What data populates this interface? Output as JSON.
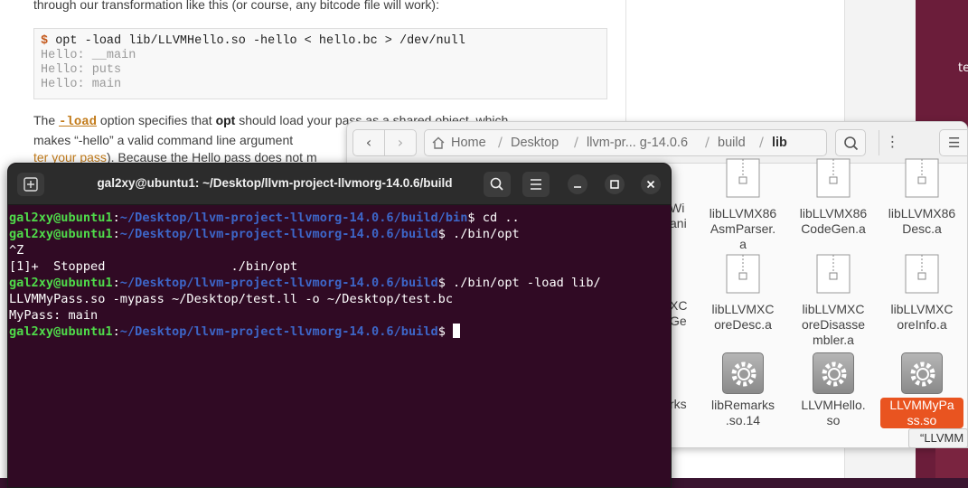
{
  "web": {
    "line1": "through our transformation like this (or course, any bitcode file will work):",
    "code": {
      "prompt": "$",
      "command": " opt -load lib/LLVMHello.so -hello < hello.bc > /dev/null",
      "out1": "Hello: __main",
      "out2": "Hello: puts",
      "out3": "Hello: main"
    },
    "para1_pre": "The ",
    "para1_opt": "-load",
    "para1_mid": " option specifies that ",
    "para1_bold": "opt",
    "para1_post": " should load your pass as a shared object, which",
    "para2": "makes “-hello” a valid command line argument",
    "para3_link": "ter your pass",
    "para3_post": "). Because the Hello pass does not m"
  },
  "desktop": {
    "strip_text": "te"
  },
  "file_manager": {
    "breadcrumbs": [
      "Home",
      "Desktop",
      "llvm-pr... g-14.0.6",
      "build",
      "lib"
    ],
    "path_menu": "⋮",
    "view_icon": "list-view-icon",
    "partial_labels": {
      "a1": "Wi",
      "a2": "ani",
      "b1": "XC",
      "b2": "Ge",
      "c1": "rks"
    },
    "items": [
      {
        "label": "libLLVMX86\nAsmParser.\na",
        "icon": "archive-icon"
      },
      {
        "label": "libLLVMX86\nCodeGen.a",
        "icon": "archive-icon"
      },
      {
        "label": "libLLVMX86\nDesc.a",
        "icon": "archive-icon"
      },
      {
        "label": "libLLVMXC\noreDesc.a",
        "icon": "archive-icon"
      },
      {
        "label": "libLLVMXC\noreDisasse\nmbler.a",
        "icon": "archive-icon"
      },
      {
        "label": "libLLVMXC\noreInfo.a",
        "icon": "archive-icon"
      },
      {
        "label": "libRemarks\n.so.14",
        "icon": "gear-icon"
      },
      {
        "label": "LLVMHello.\nso",
        "icon": "gear-icon"
      },
      {
        "label": "LLVMMyPa\nss.so",
        "icon": "gear-icon",
        "selected": true
      }
    ],
    "tooltip": "“LLVMM"
  },
  "terminal": {
    "title": "gal2xy@ubuntu1: ~/Desktop/llvm-project-llvmorg-14.0.6/build",
    "user": "gal2xy@ubuntu1",
    "lines": [
      {
        "path": "~/Desktop/llvm-project-llvmorg-14.0.6/build/bin",
        "cmd": "$ cd .."
      },
      {
        "path": "~/Desktop/llvm-project-llvmorg-14.0.6/build",
        "cmd": "$ ./bin/opt"
      },
      {
        "text": "^Z"
      },
      {
        "text": "[1]+  Stopped                 ./bin/opt"
      },
      {
        "path": "~/Desktop/llvm-project-llvmorg-14.0.6/build",
        "cmd": "$ ./bin/opt -load lib/"
      },
      {
        "text": "LLVMMyPass.so -mypass ~/Desktop/test.ll -o ~/Desktop/test.bc"
      },
      {
        "text": "MyPass: main"
      },
      {
        "path": "~/Desktop/llvm-project-llvmorg-14.0.6/build",
        "cmd": "$ "
      }
    ]
  }
}
